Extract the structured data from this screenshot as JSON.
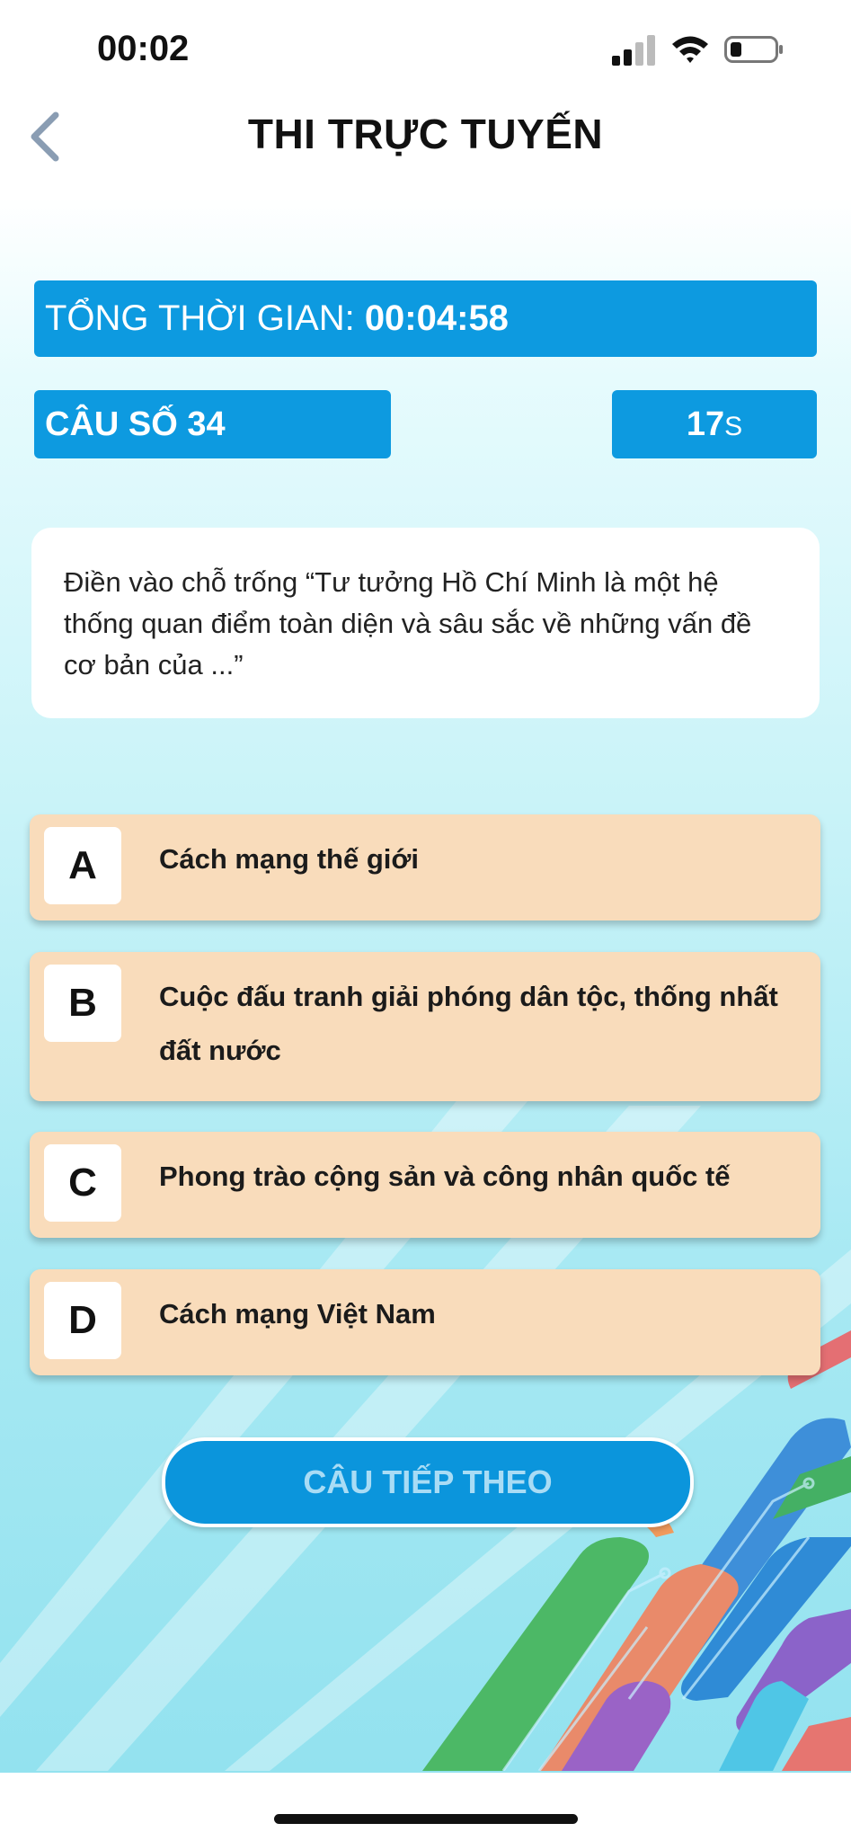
{
  "status_bar": {
    "time": "00:02"
  },
  "header": {
    "title": "THI TRỰC TUYẾN"
  },
  "timer": {
    "total_label": "TỔNG THỜI GIAN: ",
    "total_value": "00:04:58"
  },
  "question_info": {
    "number_label": "CÂU SỐ 34",
    "seconds": "17",
    "seconds_unit": "S"
  },
  "question": {
    "text": "Điền vào chỗ trống “Tư tưởng Hồ Chí Minh là một hệ thống quan điểm toàn diện và sâu sắc về những vấn đề cơ bản của ...”"
  },
  "options": [
    {
      "letter": "A",
      "text": "Cách mạng thế giới"
    },
    {
      "letter": "B",
      "text": "Cuộc đấu tranh giải phóng dân tộc, thống nhất đất nước"
    },
    {
      "letter": "C",
      "text": "Phong trào cộng sản và công nhân quốc tế"
    },
    {
      "letter": "D",
      "text": "Cách mạng Việt Nam"
    }
  ],
  "next_button": {
    "label": "CÂU TIẾP THEO"
  },
  "colors": {
    "primary": "#0d9ae0",
    "option_bg": "#f9dcbb"
  },
  "icons": {
    "back": "chevron-left-icon",
    "signal": "cellular-signal-icon",
    "wifi": "wifi-icon",
    "battery": "battery-icon"
  }
}
